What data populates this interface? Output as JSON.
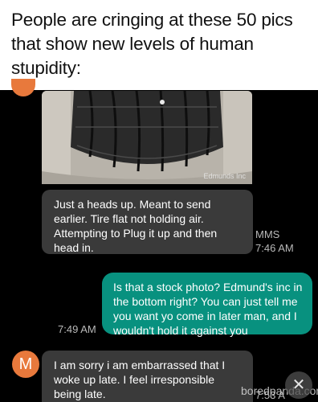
{
  "header": {
    "headline": "People are cringing at these 50 pics that show new levels of human stupidity:"
  },
  "chat": {
    "photo_watermark": "Edmunds Inc",
    "incoming_1": {
      "text": "Just a heads up. Meant to send earlier. Tire flat not holding air. Attempting to Plug it up and then head in.",
      "type_label": "MMS",
      "time": "7:46 AM"
    },
    "outgoing_1": {
      "text": "Is that a stock photo? Edmund's inc in the bottom right? You can just tell me you want yo come in later man, and I wouldn't hold it against you",
      "time": "7:49 AM"
    },
    "incoming_2": {
      "avatar_letter": "M",
      "text": "I am sorry i am embarrassed that I woke up late. I feel irresponsible being late.",
      "time": "7:53 A"
    }
  },
  "overlay": {
    "site_watermark": "boredpanda.com",
    "close_glyph": "✕"
  },
  "colors": {
    "incoming_bubble": "#3a3a3a",
    "outgoing_bubble": "#08917f",
    "avatar": "#e8793c"
  }
}
